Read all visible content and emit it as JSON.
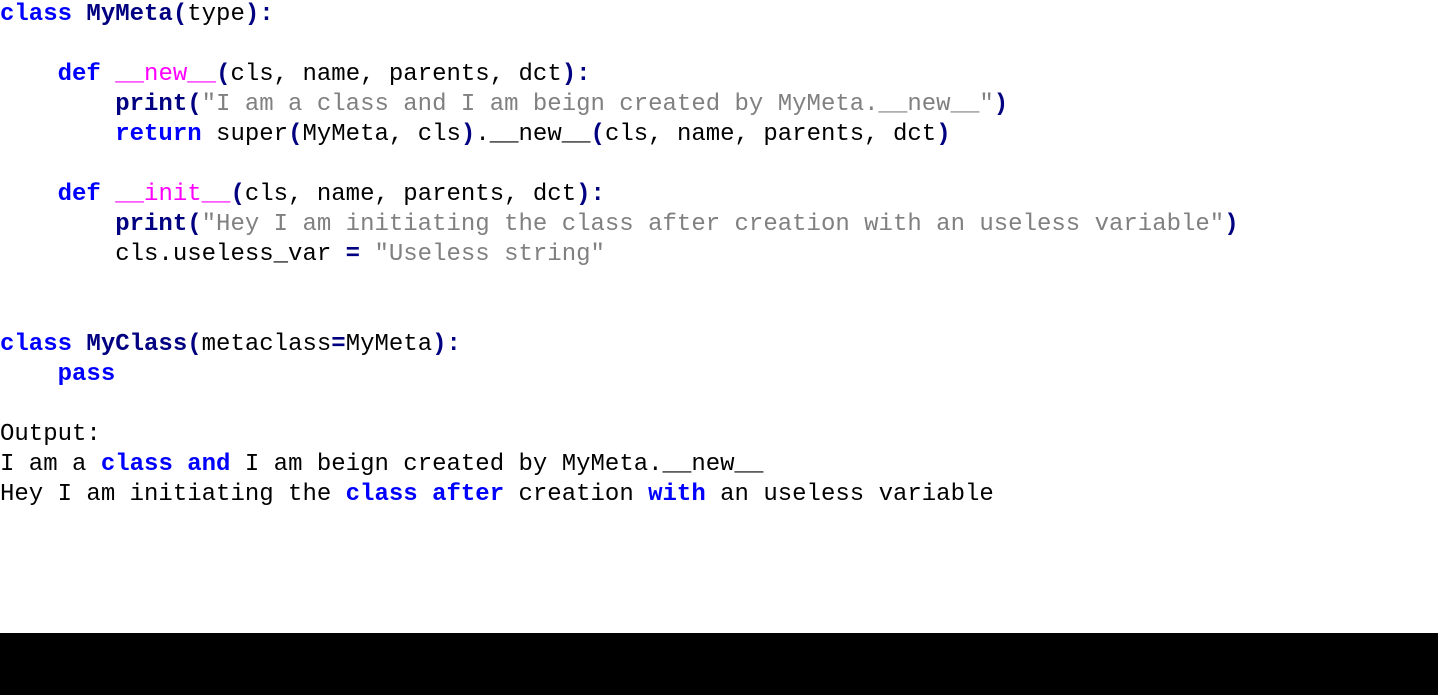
{
  "code": {
    "l1_class": "class",
    "l1_name": "MyMeta",
    "l1_paren_o": "(",
    "l1_base": "type",
    "l1_paren_c": "):",
    "l3_def": "def",
    "l3_fn": "__new__",
    "l3_paren_o": "(",
    "l3_args": "cls, name, parents, dct",
    "l3_paren_c": "):",
    "l4_print": "print",
    "l4_paren_o": "(",
    "l4_str": "\"I am a class and I am beign created by MyMeta.__new__\"",
    "l4_paren_c": ")",
    "l5_return": "return",
    "l5_super": " super",
    "l5_po1": "(",
    "l5_args1": "MyMeta, cls",
    "l5_pc1": ")",
    "l5_dot": ".__new__",
    "l5_po2": "(",
    "l5_args2": "cls, name, parents, dct",
    "l5_pc2": ")",
    "l7_def": "def",
    "l7_fn": "__init__",
    "l7_paren_o": "(",
    "l7_args": "cls, name, parents, dct",
    "l7_paren_c": "):",
    "l8_print": "print",
    "l8_paren_o": "(",
    "l8_str": "\"Hey I am initiating the class after creation with an useless variable\"",
    "l8_paren_c": ")",
    "l9_lhs": "        cls.useless_var ",
    "l9_eq": "=",
    "l9_str": " \"Useless string\"",
    "l12_class": "class",
    "l12_name": "MyClass",
    "l12_po": "(",
    "l12_meta_kw": "metaclass",
    "l12_eq": "=",
    "l12_meta_val": "MyMeta",
    "l12_pc": "):",
    "l13_pass": "pass",
    "l15_out": "Output:",
    "l16_a": "I am a ",
    "l16_b": "class",
    "l16_c": " ",
    "l16_d": "and",
    "l16_e": " I am beign created by MyMeta.__new__",
    "l17_a": "Hey I am initiating the ",
    "l17_b": "class",
    "l17_c": " ",
    "l17_d": "after",
    "l17_e": " creation ",
    "l17_f": "with",
    "l17_g": " an useless variable"
  }
}
